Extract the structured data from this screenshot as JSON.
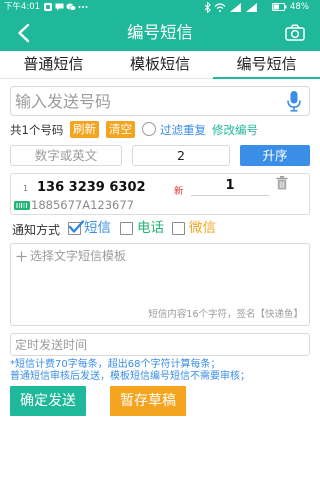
{
  "status_bar": {
    "time": "下午4:01",
    "battery": "48%",
    "left_icons": [
      "app-notification-icon",
      "message-icon",
      "wechat-icon",
      "more-icon"
    ],
    "right_icons": [
      "bluetooth-icon",
      "wifi-icon",
      "signal-icon",
      "signal-icon",
      "battery-icon"
    ]
  },
  "header": {
    "title": "编号短信",
    "back_icon": "back-chevron-icon",
    "action_icon": "camera-icon"
  },
  "tabs": [
    {
      "label": "普通短信",
      "active": false
    },
    {
      "label": "模板短信",
      "active": false
    },
    {
      "label": "编号短信",
      "active": true
    }
  ],
  "phone_input": {
    "placeholder": "输入发送号码",
    "icon": "microphone-icon"
  },
  "toolbar": {
    "count_text": "共1个号码",
    "refresh_label": "刷新",
    "clear_label": "清空",
    "filter_duplicates_checked": false,
    "filter_label": "过滤重复",
    "edit_label": "修改编号"
  },
  "numbering": {
    "prefix_placeholder": "数字或英文",
    "start_value": "2",
    "sort_label": "升序"
  },
  "entries": [
    {
      "index": "1",
      "phone": "136 3239 6302",
      "tag": "新",
      "code": "1",
      "tracking_number": "1885677A123677",
      "tracking_icon": "barcode-icon",
      "delete_icon": "trash-icon"
    }
  ],
  "notify": {
    "label": "通知方式",
    "options": [
      {
        "label": "短信",
        "checked": true,
        "color": "#3a8ee6"
      },
      {
        "label": "电话",
        "checked": false,
        "color": "#22b573"
      },
      {
        "label": "微信",
        "checked": false,
        "color": "#f5a41f"
      }
    ]
  },
  "template": {
    "picker_label": "选择文字短信模板",
    "picker_icon": "plus-icon",
    "counter": "短信内容16个字符，签名【快递鱼】"
  },
  "schedule": {
    "placeholder": "定时发送时间"
  },
  "notes": [
    "*短信计费70字每条，超出68个字符计算每条；",
    "普通短信审核后发送，模板短信编号短信不需要审核；"
  ],
  "actions": {
    "send_label": "确定发送",
    "draft_label": "暂存草稿"
  },
  "colors": {
    "primary": "#1fb89b",
    "orange": "#f5a41f",
    "blue": "#3a8ee6",
    "red": "#e53935",
    "green": "#22b573"
  }
}
